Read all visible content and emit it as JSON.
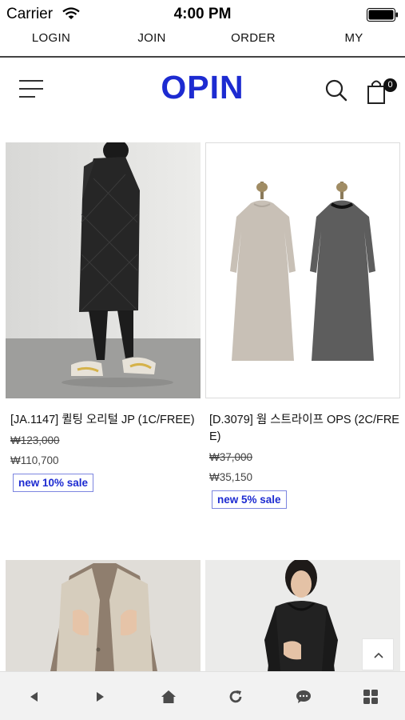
{
  "status_bar": {
    "carrier": "Carrier",
    "time": "4:00 PM"
  },
  "top_links": [
    "LOGIN",
    "JOIN",
    "ORDER",
    "MY"
  ],
  "header": {
    "logo": "OPIN",
    "cart_count": "0"
  },
  "products": [
    {
      "name": "[JA.1147] 퀼팅 오리털 JP (1C/FREE)",
      "price_original": "₩123,000",
      "price_sale": "₩110,700",
      "badge": "new 10% sale"
    },
    {
      "name": "[D.3079] 웜 스트라이프 OPS (2C/FREE)",
      "price_original": "₩37,000",
      "price_sale": "₩35,150",
      "badge": "new 5% sale"
    }
  ],
  "colors": {
    "brand": "#1d2bd1",
    "toolbar_bg": "#f2f2f2"
  },
  "icons": [
    "wifi-icon",
    "battery-icon",
    "hamburger-menu-icon",
    "search-icon",
    "shopping-bag-icon",
    "chevron-up-icon",
    "back-arrow-icon",
    "forward-arrow-icon",
    "home-icon",
    "refresh-icon",
    "chat-icon",
    "grid-icon"
  ]
}
